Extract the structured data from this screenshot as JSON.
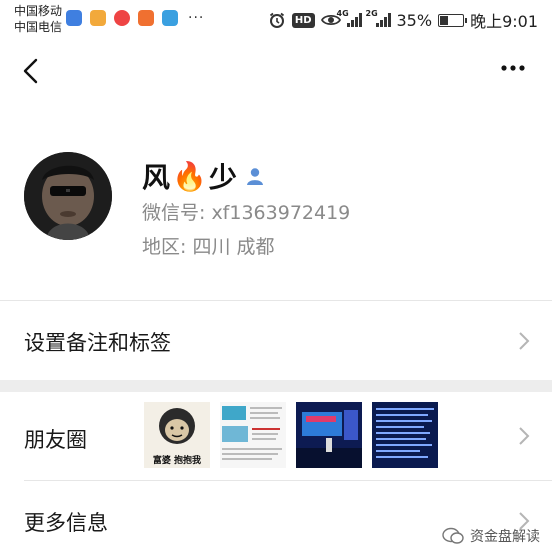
{
  "status_bar": {
    "carrier_1": "中国移动",
    "carrier_2": "中国电信",
    "more": "···",
    "hd": "HD",
    "net_1": "4G",
    "net_2": "2G",
    "battery_percent": "35%",
    "battery_level": 0.35,
    "time": "晚上9:01"
  },
  "nav": {
    "back_icon": "chevron-left-icon",
    "more_icon": "more-dots-icon"
  },
  "profile": {
    "nickname_part1": "风",
    "nickname_emoji": "🔥",
    "nickname_part2": "少",
    "gender_icon": "user-icon",
    "wechat_id": "微信号: xf1363972419",
    "region": "地区: 四川  成都"
  },
  "rows": {
    "remark_tags": "设置备注和标签",
    "moments": "朋友圈",
    "more_info": "更多信息"
  },
  "moments_thumbs": {
    "thumb1_caption": "富婆  抱抱我"
  },
  "watermark": {
    "text": "资金盘解读"
  },
  "colors": {
    "accent_blue": "#5b8fd6",
    "text_primary": "#191919",
    "text_secondary": "#8a8a8a",
    "section_gap": "#ededed"
  }
}
